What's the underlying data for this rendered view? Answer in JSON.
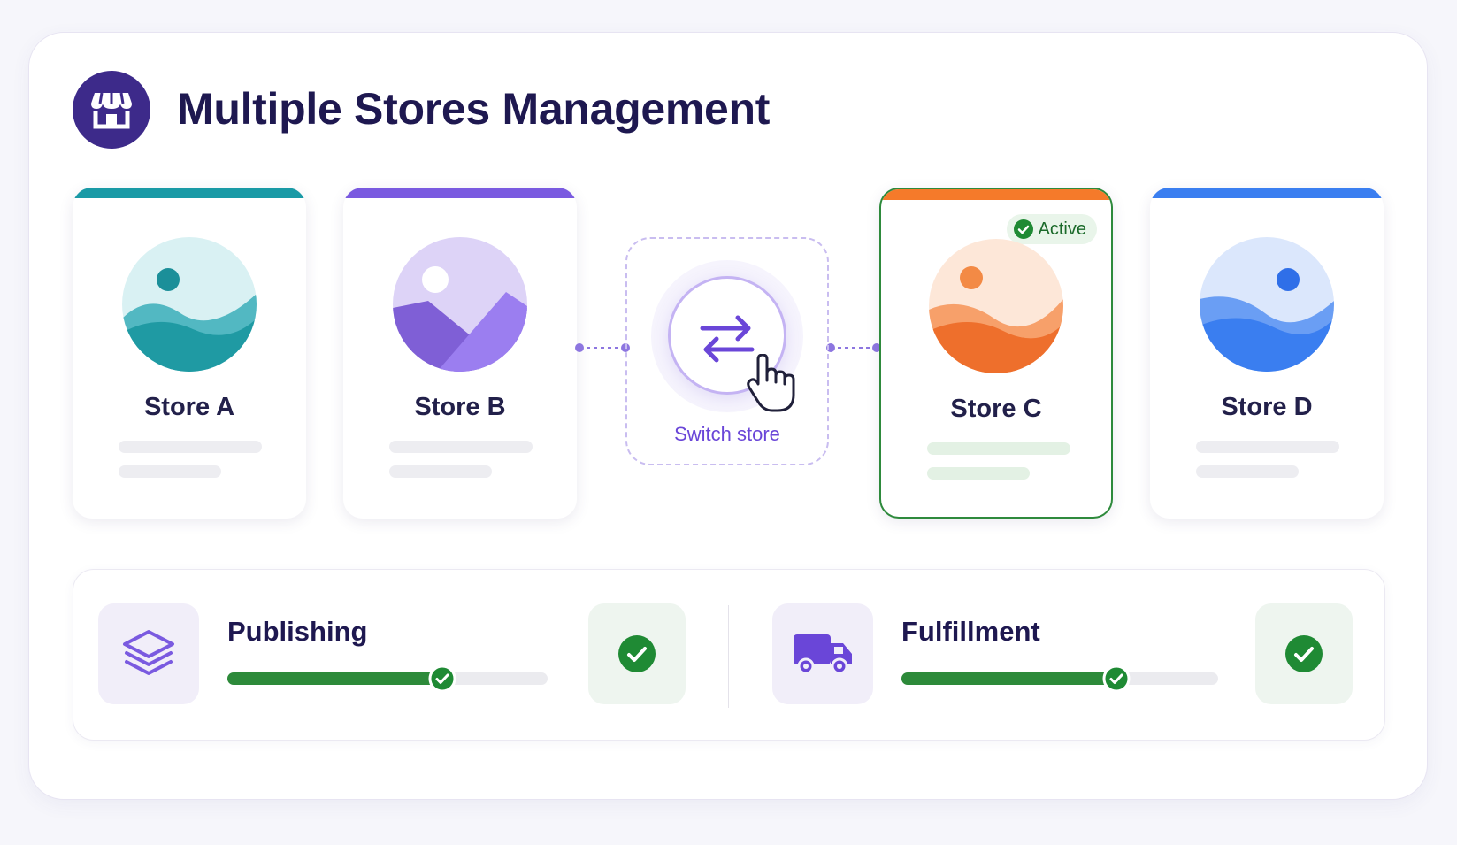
{
  "header": {
    "title": "Multiple Stores Management",
    "logo_icon": "storefront-icon"
  },
  "stores": [
    {
      "name": "Store A",
      "accent": "#1a9aa6",
      "active": false
    },
    {
      "name": "Store B",
      "accent": "#7a5ae0",
      "active": false
    },
    {
      "name": "Store C",
      "accent": "#f57a2a",
      "active": true
    },
    {
      "name": "Store D",
      "accent": "#3a7ef0",
      "active": false
    }
  ],
  "active_badge": {
    "label": "Active",
    "color": "#2e8a3c"
  },
  "switcher": {
    "label": "Switch store",
    "icons": [
      "swap-arrows-icon",
      "hand-pointer-icon"
    ]
  },
  "status": {
    "publishing": {
      "label": "Publishing",
      "progress": 0.67,
      "icon": "layers-icon",
      "complete": true
    },
    "fulfillment": {
      "label": "Fulfillment",
      "progress": 0.68,
      "icon": "truck-icon",
      "complete": true
    }
  }
}
